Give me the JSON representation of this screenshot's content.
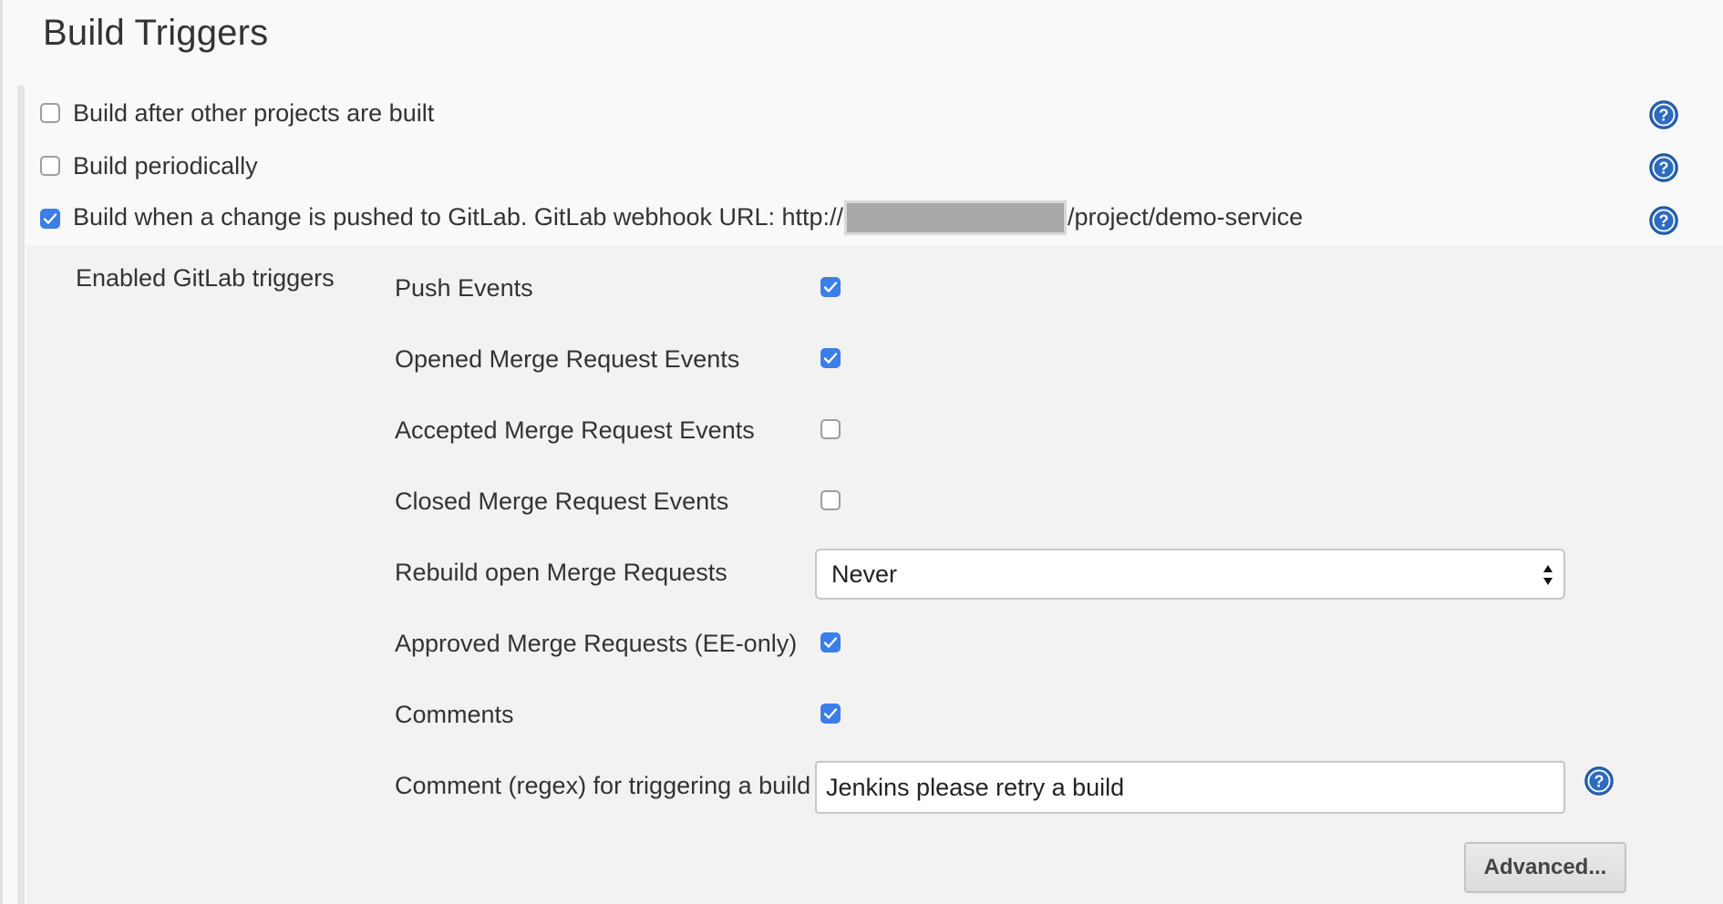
{
  "section": {
    "title": "Build Triggers"
  },
  "triggers": [
    {
      "label": "Build after other projects are built",
      "checked": false
    },
    {
      "label": "Build periodically",
      "checked": false
    },
    {
      "label_prefix": "Build when a change is pushed to GitLab. GitLab webhook URL: http://",
      "label_suffix": "/project/demo-service",
      "checked": true
    }
  ],
  "gitlab": {
    "panel_label": "Enabled GitLab triggers",
    "options": [
      {
        "label": "Push Events",
        "checked": true
      },
      {
        "label": "Opened Merge Request Events",
        "checked": true
      },
      {
        "label": "Accepted Merge Request Events",
        "checked": false
      },
      {
        "label": "Closed Merge Request Events",
        "checked": false
      },
      {
        "label": "Rebuild open Merge Requests"
      },
      {
        "label": "Approved Merge Requests (EE-only)",
        "checked": true
      },
      {
        "label": "Comments",
        "checked": true
      },
      {
        "label": "Comment (regex) for triggering a build"
      }
    ],
    "rebuild_select": {
      "selected": "Never"
    },
    "comment_regex": {
      "value": "Jenkins please retry a build"
    },
    "advanced_label": "Advanced..."
  },
  "colors": {
    "checkbox_checked": "#3a7ee6",
    "help_icon": "#2d6bbf"
  },
  "icons": {
    "help": "question-mark-circle-icon",
    "check": "checkmark-icon",
    "select": "updown-arrows-icon"
  }
}
